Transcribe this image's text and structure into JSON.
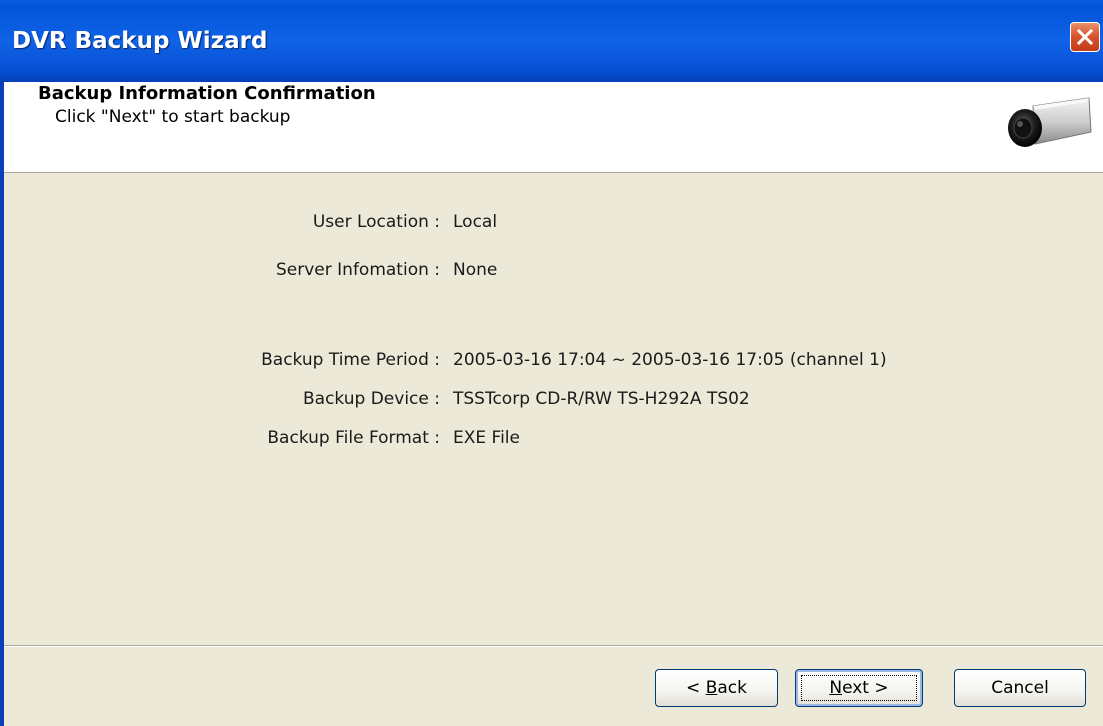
{
  "window": {
    "title": "DVR Backup Wizard"
  },
  "header": {
    "title": "Backup Information Confirmation",
    "subtitle": "Click \"Next\" to start backup",
    "icon": "security-camera-icon"
  },
  "info": {
    "user_location": {
      "label": "User Location :",
      "value": "Local"
    },
    "server_information": {
      "label": "Server Infomation :",
      "value": "None"
    },
    "backup_time_period": {
      "label": "Backup Time Period :",
      "value": "2005-03-16 17:04 ~ 2005-03-16 17:05 (channel 1)"
    },
    "backup_device": {
      "label": "Backup Device :",
      "value": "TSSTcorp CD-R/RW TS-H292A TS02"
    },
    "backup_file_format": {
      "label": "Backup File Format :",
      "value": "EXE File"
    }
  },
  "buttons": {
    "back": {
      "prefix": "< ",
      "mnemonic": "B",
      "rest": "ack"
    },
    "next": {
      "mnemonic": "N",
      "rest": "ext >"
    },
    "cancel": "Cancel"
  },
  "colors": {
    "titlebar": "#0f63e6",
    "dialog_bg": "#ece9d8",
    "close_button": "#d9512c"
  }
}
